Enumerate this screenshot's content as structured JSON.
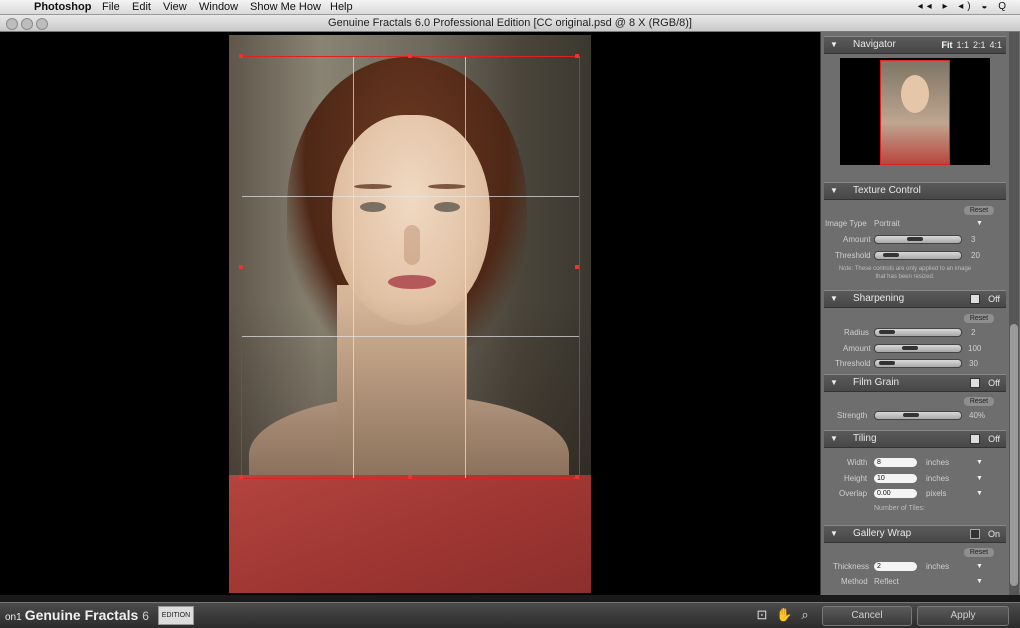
{
  "menubar": {
    "app": "Photoshop",
    "items": [
      "File",
      "Edit",
      "View",
      "Window",
      "Show Me How",
      "Help"
    ],
    "status_icons": "◂◂ ▸ ◂) ◒ Q"
  },
  "window": {
    "title": "Genuine Fractals 6.0 Professional Edition [CC original.psd @ 8 X (RGB/8)]"
  },
  "navigator": {
    "title": "Navigator",
    "zoom_options": [
      "Fit",
      "1:1",
      "2:1",
      "4:1"
    ]
  },
  "texture_control": {
    "title": "Texture Control",
    "reset": "Reset",
    "image_type_label": "Image Type",
    "image_type_value": "Portrait",
    "amount_label": "Amount",
    "amount_value": "3",
    "amount_level": 0.45,
    "threshold_label": "Threshold",
    "threshold_value": "20",
    "threshold_level": 0.1,
    "note": "Note: These controls are only applied to an image that has been resized."
  },
  "sharpening": {
    "title": "Sharpening",
    "state": "Off",
    "reset": "Reset",
    "radius_label": "Radius",
    "radius_value": "2",
    "radius_level": 0.05,
    "amount_label": "Amount",
    "amount_value": "100",
    "amount_level": 0.38,
    "threshold_label": "Threshold",
    "threshold_value": "30",
    "threshold_level": 0.05
  },
  "film_grain": {
    "title": "Film Grain",
    "state": "Off",
    "reset": "Reset",
    "strength_label": "Strength",
    "strength_value": "40%",
    "strength_level": 0.4
  },
  "tiling": {
    "title": "Tiling",
    "state": "Off",
    "width_label": "Width",
    "width_value": "8",
    "width_unit": "inches",
    "height_label": "Height",
    "height_value": "10",
    "height_unit": "inches",
    "overlap_label": "Overlap",
    "overlap_value": "0.00",
    "overlap_unit": "pixels",
    "tiles_label": "Number of Tiles:"
  },
  "gallery_wrap": {
    "title": "Gallery Wrap",
    "state": "On",
    "reset": "Reset",
    "thickness_label": "Thickness",
    "thickness_value": "2",
    "thickness_unit": "inches",
    "method_label": "Method",
    "method_value": "Reflect"
  },
  "bottom": {
    "brand_logo": "on1",
    "brand": "Genuine Fractals",
    "version": "6",
    "edition_badge": "EDITION",
    "cancel": "Cancel",
    "apply": "Apply"
  }
}
